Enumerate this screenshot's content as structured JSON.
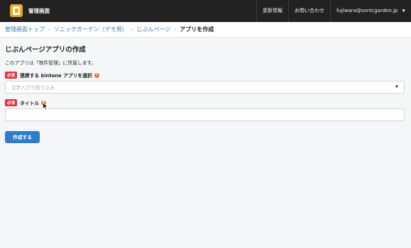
{
  "header": {
    "brand_title": "管理画面",
    "nav": {
      "updates": "更新情報",
      "contact": "お問い合わせ",
      "user_email": "fujiwara@sonicgarden.jp"
    }
  },
  "breadcrumb": {
    "items": [
      "管理画面トップ",
      "ソニックガーデン（デモ用）",
      "じぶんページ"
    ],
    "current": "アプリを作成"
  },
  "main": {
    "title": "じぶんページアプリの作成",
    "description": "このアプリは「物件管理」に所属します。",
    "required_badge": "必須",
    "field_app": {
      "label": "連携する kintone アプリを選択",
      "placeholder": "文字入力で絞り込み"
    },
    "field_title": {
      "label": "タイトル",
      "value": ""
    },
    "submit_label": "作成する"
  }
}
